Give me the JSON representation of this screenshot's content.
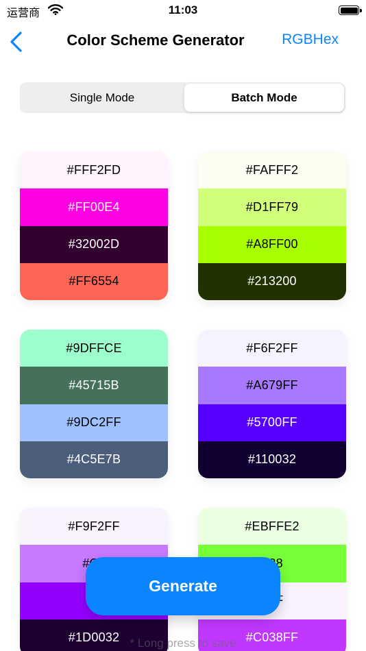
{
  "status_bar": {
    "carrier": "运营商",
    "time": "11:03"
  },
  "nav": {
    "title": "Color Scheme Generator",
    "right_label": "RGBHex"
  },
  "segments": {
    "single": "Single Mode",
    "batch": "Batch Mode",
    "selected": "Batch Mode"
  },
  "cards": [
    {
      "swatches": [
        {
          "hex": "#FFF2FD",
          "color": "#FFF2FD",
          "text_color": "#000000"
        },
        {
          "hex": "#FF00E4",
          "color": "#FF00E4",
          "text_color": "#FFFFFF"
        },
        {
          "hex": "#32002D",
          "color": "#32002D",
          "text_color": "#FFFFFF"
        },
        {
          "hex": "#FF6554",
          "color": "#FF6554",
          "text_color": "#000000"
        }
      ]
    },
    {
      "swatches": [
        {
          "hex": "#FAFFF2",
          "color": "#FAFFF2",
          "text_color": "#000000"
        },
        {
          "hex": "#D1FF79",
          "color": "#D1FF79",
          "text_color": "#000000"
        },
        {
          "hex": "#A8FF00",
          "color": "#A8FF00",
          "text_color": "#000000"
        },
        {
          "hex": "#213200",
          "color": "#213200",
          "text_color": "#FFFFFF"
        }
      ]
    },
    {
      "swatches": [
        {
          "hex": "#9DFFCE",
          "color": "#9DFFCE",
          "text_color": "#000000"
        },
        {
          "hex": "#45715B",
          "color": "#45715B",
          "text_color": "#FFFFFF"
        },
        {
          "hex": "#9DC2FF",
          "color": "#9DC2FF",
          "text_color": "#000000"
        },
        {
          "hex": "#4C5E7B",
          "color": "#4C5E7B",
          "text_color": "#FFFFFF"
        }
      ]
    },
    {
      "swatches": [
        {
          "hex": "#F6F2FF",
          "color": "#F6F2FF",
          "text_color": "#000000"
        },
        {
          "hex": "#A679FF",
          "color": "#A679FF",
          "text_color": "#000000"
        },
        {
          "hex": "#5700FF",
          "color": "#5700FF",
          "text_color": "#FFFFFF"
        },
        {
          "hex": "#110032",
          "color": "#110032",
          "text_color": "#FFFFFF"
        }
      ]
    },
    {
      "swatches": [
        {
          "hex": "#F9F2FF",
          "color": "#F9F2FF",
          "text_color": "#000000"
        },
        {
          "hex": "#C7",
          "color": "#C779FF",
          "text_color": "#000000"
        },
        {
          "hex": "#9",
          "color": "#9400FF",
          "text_color": "#FFFFFF"
        },
        {
          "hex": "#1D0032",
          "color": "#1D0032",
          "text_color": "#FFFFFF"
        }
      ]
    },
    {
      "swatches": [
        {
          "hex": "#EBFFE2",
          "color": "#EBFFE2",
          "text_color": "#000000"
        },
        {
          "hex": "F38",
          "color": "#77FF38",
          "text_color": "#000000"
        },
        {
          "hex": "2FF",
          "color": "#FAF2FF",
          "text_color": "#000000"
        },
        {
          "hex": "#C038FF",
          "color": "#C038FF",
          "text_color": "#FFFFFF"
        }
      ]
    }
  ],
  "generate_label": "Generate",
  "hint": "* Long press to save",
  "colors": {
    "accent": "#0A84FF",
    "segment_bg": "#EEEEEF"
  },
  "icons": {
    "back": "chevron-left-icon",
    "wifi": "wifi-icon",
    "battery": "battery-icon"
  }
}
